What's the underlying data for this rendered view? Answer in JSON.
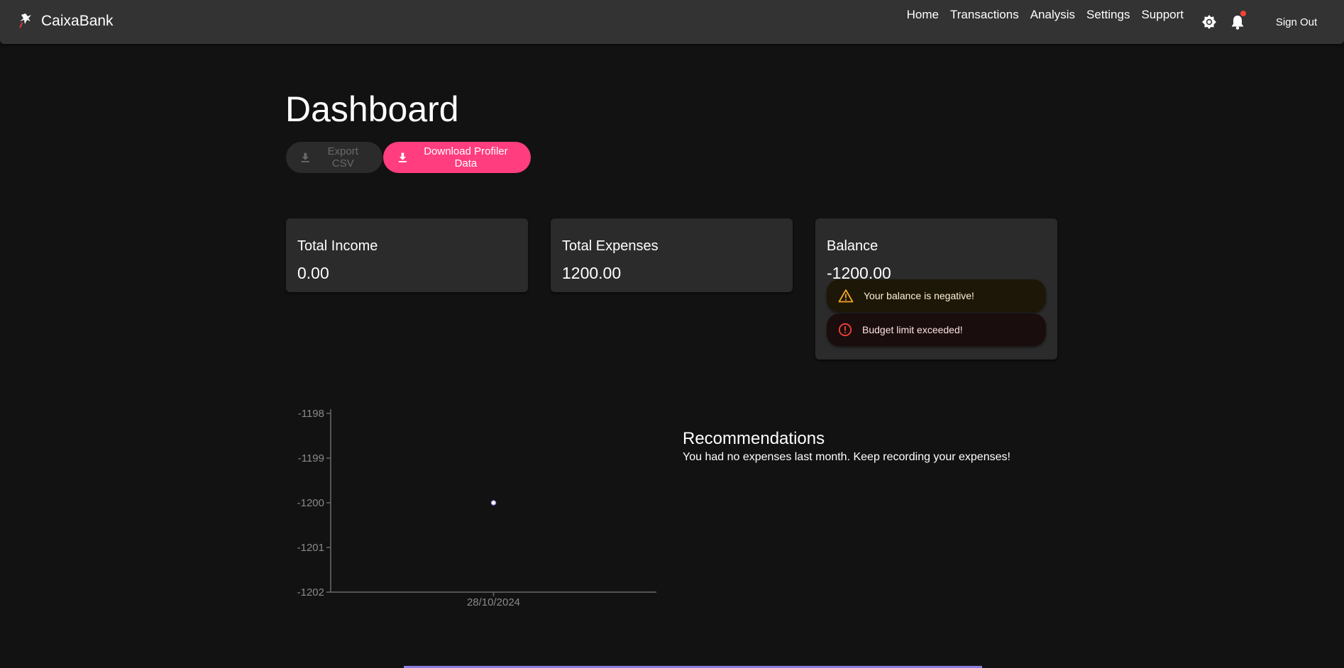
{
  "header": {
    "brand": "CaixaBank",
    "nav": [
      "Home",
      "Transactions",
      "Analysis",
      "Settings",
      "Support"
    ],
    "icons": {
      "logo": "caixabank-star-icon",
      "theme": "brightness-icon",
      "notifications": "bell-icon"
    },
    "notification_dot_color": "#f44336",
    "sign_out": "Sign Out"
  },
  "page": {
    "title": "Dashboard",
    "actions": {
      "export_csv": "Export CSV",
      "download_profiler": "Download Profiler Data",
      "accent_color": "#ff3d7f"
    }
  },
  "summary": {
    "income": {
      "label": "Total Income",
      "value": "0.00"
    },
    "expenses": {
      "label": "Total Expenses",
      "value": "1200.00"
    },
    "balance": {
      "label": "Balance",
      "value": "-1200.00"
    }
  },
  "alerts": [
    {
      "type": "warning",
      "icon": "warning-triangle-icon",
      "text": "Your balance is negative!",
      "color": "#f5a623"
    },
    {
      "type": "error",
      "icon": "error-circle-icon",
      "text": "Budget limit exceeded!",
      "color": "#f44336"
    }
  ],
  "chart_data": {
    "type": "line",
    "x": [
      "28/10/2024"
    ],
    "series": [
      {
        "values": [
          -1200
        ]
      }
    ],
    "y_ticks": [
      -1198,
      -1199,
      -1200,
      -1201,
      -1202
    ],
    "ylim": [
      -1202,
      -1198
    ],
    "title": "",
    "xlabel": "",
    "ylabel": "",
    "grid": false
  },
  "recommendations": {
    "title": "Recommendations",
    "text": "You had no expenses last month. Keep recording your expenses!"
  }
}
